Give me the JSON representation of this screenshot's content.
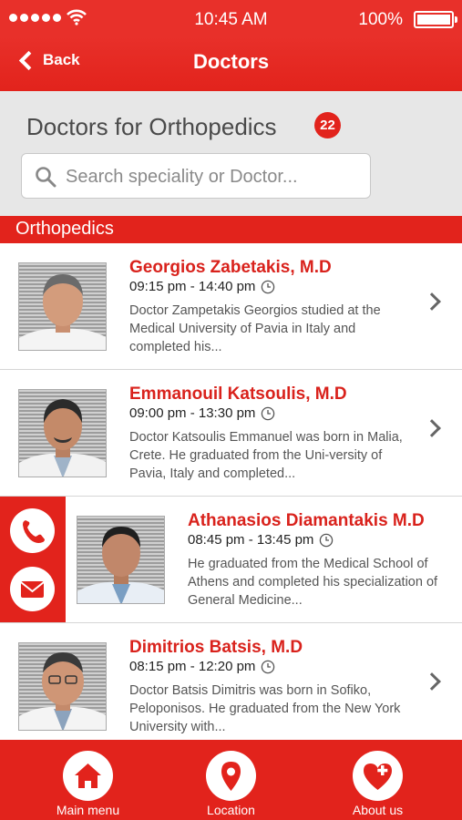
{
  "status": {
    "time": "10:45 AM",
    "battery": "100%",
    "battery_level": 1.0,
    "signal_bars": 5
  },
  "nav": {
    "back_label": "Back",
    "title": "Doctors"
  },
  "header": {
    "title": "Doctors for Orthopedics",
    "count": "22"
  },
  "search": {
    "placeholder": "Search speciality or Doctor..."
  },
  "section": {
    "label": "Orthopedics"
  },
  "doctors": [
    {
      "name": "Georgios Zabetakis, M.D",
      "hours": "09:15 pm - 14:40 pm",
      "description": "Doctor Zampetakis Georgios studied at the Medical University of Pavia in Italy and completed his..."
    },
    {
      "name": "Emmanouil Katsoulis, M.D",
      "hours": "09:00 pm - 13:30 pm",
      "description": "Doctor Katsoulis Emmanuel was born in Malia, Crete. He graduated from the Uni-versity of Pavia, Italy and completed..."
    },
    {
      "name": "Athanasios Diamantakis M.D",
      "hours": "08:45 pm - 13:45 pm",
      "description": "He graduated from the Medical School of Athens and completed his specialization of General Medicine..."
    },
    {
      "name": "Dimitrios Batsis, M.D",
      "hours": "08:15 pm - 12:20 pm",
      "description": "Doctor Batsis Dimitris was born in Sofiko, Peloponisos. He graduated from the New York University with..."
    }
  ],
  "tabs": [
    {
      "label": "Main menu",
      "icon": "home-icon"
    },
    {
      "label": "Location",
      "icon": "location-pin-icon"
    },
    {
      "label": "About us",
      "icon": "heart-plus-icon"
    }
  ],
  "colors": {
    "brand_red": "#e2231c",
    "header_gray": "#e7e7e7",
    "text_gray": "#555555"
  }
}
